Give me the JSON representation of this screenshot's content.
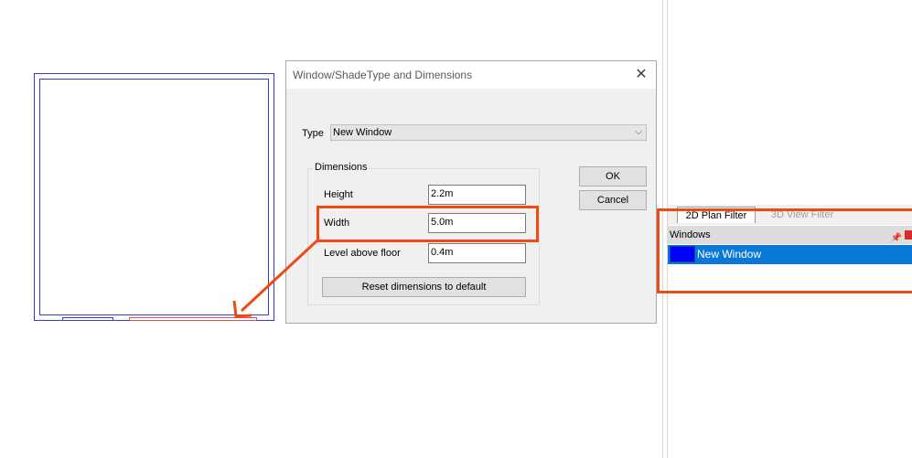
{
  "dialog": {
    "title": "Window/ShadeType and Dimensions",
    "type_label": "Type",
    "type_value": "New Window",
    "group_title": "Dimensions",
    "height_label": "Height",
    "height_value": "2.2m",
    "width_label": "Width",
    "width_value": "5.0m",
    "level_label": "Level above floor",
    "level_value": "0.4m",
    "reset_label": "Reset dimensions to default",
    "ok_label": "OK",
    "cancel_label": "Cancel"
  },
  "panel": {
    "tab_plan": "2D Plan Filter",
    "tab_view": "3D View Filter",
    "header": "Windows",
    "items": [
      {
        "label": "New Window",
        "color": "#0000ff"
      }
    ]
  },
  "annotation_color": "#f04a14"
}
